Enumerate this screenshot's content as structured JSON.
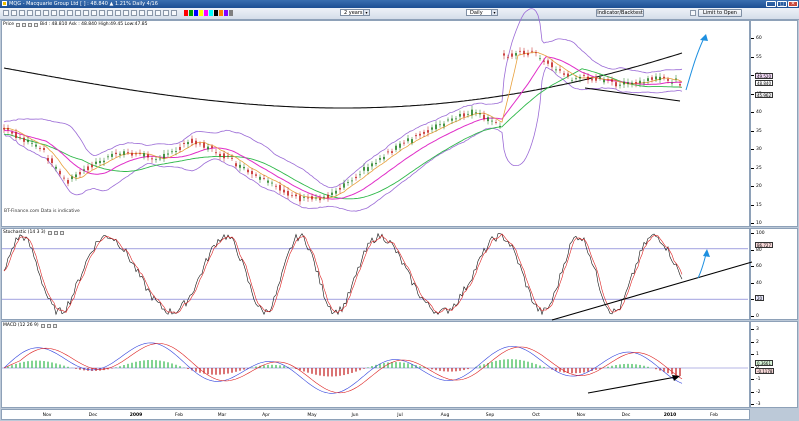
{
  "window": {
    "title": "MQG - Macquarie Group Ltd [ ] : 48.840 ▲ 1.21%  Daily  4/16",
    "controls": [
      "_",
      "□",
      "✕"
    ]
  },
  "toolbar": {
    "period": "2 years",
    "interval": "Daily",
    "indicator_button": "Indicator/Backtest",
    "link_button": "Limit to Open",
    "swatches": [
      "#ff0000",
      "#00a000",
      "#0000ff",
      "#ffff00",
      "#ff00ff",
      "#00ffff",
      "#000000",
      "#ff8000",
      "#8000ff",
      "#808080"
    ]
  },
  "price_panel": {
    "label": "Price",
    "quote": "Bid : 48.810 Ask : 48.840 High:49.45 Low:47.85",
    "axis_ticks": [
      "60",
      "55",
      "50",
      "45",
      "40",
      "35",
      "30",
      "25",
      "20",
      "15",
      "10"
    ],
    "badges": [
      "49.520",
      "48.840",
      "45.962"
    ],
    "copyright": "BT-Finance.com  Data is indicative"
  },
  "stoch_panel": {
    "label": "Stochastic (14 3 3)",
    "axis_ticks": [
      "100",
      "80",
      "60",
      "40",
      "20",
      "0"
    ],
    "badges": [
      "86.727",
      "20"
    ]
  },
  "macd_panel": {
    "label": "MACD (12 26 9)",
    "axis_ticks": [
      "3",
      "2",
      "1",
      "0",
      "-1",
      "-2",
      "-3"
    ],
    "badges": [
      "0.3661",
      "-0.1178"
    ]
  },
  "x_axis": {
    "labels": [
      "Nov",
      "Dec",
      "2009",
      "Feb",
      "Mar",
      "Apr",
      "May",
      "Jun",
      "Jul",
      "Aug",
      "Sep",
      "Oct",
      "Nov",
      "Dec",
      "2010",
      "Feb"
    ],
    "year_labels": [
      "2009",
      "2010"
    ]
  },
  "colors": {
    "bollinger": "#9b6bd6",
    "ma_fast": "#e8a03c",
    "ma_mid": "#e02ec8",
    "ma_slow": "#2fb84a",
    "ma_200": "#111111",
    "annotation": "#1e90e0",
    "candle_up": "#1a7a1a",
    "candle_down": "#c01818"
  }
}
